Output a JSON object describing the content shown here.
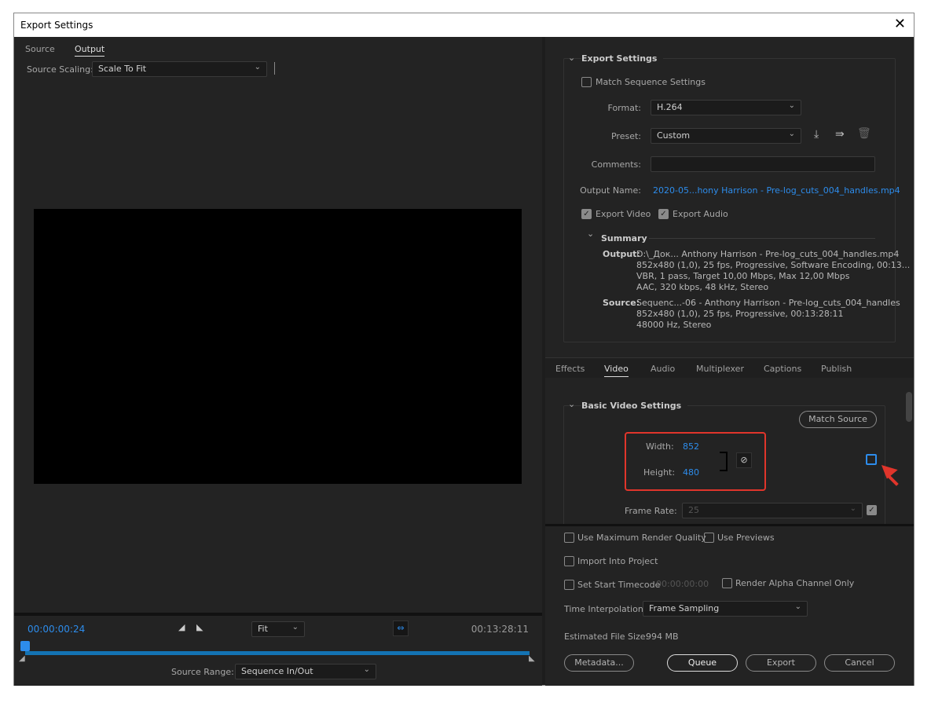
{
  "window": {
    "title": "Export Settings",
    "close_icon": "close-icon"
  },
  "left": {
    "tabs": [
      {
        "label": "Source"
      },
      {
        "label": "Output",
        "active": true
      }
    ],
    "source_scaling_label": "Source Scaling:",
    "source_scaling_value": "Scale To Fit",
    "current_time": "00:00:00:24",
    "fit_value": "Fit",
    "duration": "00:13:28:11",
    "playhead_progress": 0.002,
    "source_range_label": "Source Range:",
    "source_range_value": "Sequence In/Out"
  },
  "export_settings": {
    "title": "Export Settings",
    "match_sequence_label": "Match Sequence Settings",
    "match_sequence_checked": false,
    "format_label": "Format:",
    "format_value": "H.264",
    "preset_label": "Preset:",
    "preset_value": "Custom",
    "comments_label": "Comments:",
    "comments_value": "",
    "output_name_label": "Output Name:",
    "output_name_value": "2020-05...hony Harrison - Pre-log_cuts_004_handles.mp4",
    "export_video_label": "Export Video",
    "export_video_checked": true,
    "export_audio_label": "Export Audio",
    "export_audio_checked": true,
    "summary": {
      "title": "Summary",
      "output_label": "Output:",
      "output_lines": [
        "D:\\_Док... Anthony Harrison - Pre-log_cuts_004_handles.mp4",
        "852x480 (1,0), 25 fps, Progressive, Software Encoding, 00:13...",
        "VBR, 1 pass, Target 10,00 Mbps, Max 12,00 Mbps",
        "AAC, 320 kbps, 48 kHz, Stereo"
      ],
      "source_label": "Source:",
      "source_lines": [
        "Sequenc...-06 - Anthony Harrison - Pre-log_cuts_004_handles",
        "852x480 (1,0), 25 fps, Progressive, 00:13:28:11",
        "48000 Hz, Stereo"
      ]
    }
  },
  "settings_tabs": [
    {
      "label": "Effects"
    },
    {
      "label": "Video",
      "active": true
    },
    {
      "label": "Audio"
    },
    {
      "label": "Multiplexer"
    },
    {
      "label": "Captions"
    },
    {
      "label": "Publish"
    }
  ],
  "basic_video": {
    "title": "Basic Video Settings",
    "match_source_label": "Match Source",
    "width_label": "Width:",
    "width_value": "852",
    "height_label": "Height:",
    "height_value": "480",
    "frame_rate_label": "Frame Rate:",
    "frame_rate_value": "25",
    "frame_rate_checked": true,
    "highlight_color": "#e0352b",
    "accent": "#2d8ceb"
  },
  "bottom": {
    "max_render_label": "Use Maximum Render Quality",
    "use_previews_label": "Use Previews",
    "import_label": "Import Into Project",
    "start_tc_label": "Set Start Timecode",
    "start_tc_value": "00:00:00:00",
    "alpha_label": "Render Alpha Channel Only",
    "time_interp_label": "Time Interpolation:",
    "time_interp_value": "Frame Sampling",
    "file_size_label": "Estimated File Size:",
    "file_size_value": "994 MB",
    "metadata_label": "Metadata...",
    "queue_label": "Queue",
    "export_label": "Export",
    "cancel_label": "Cancel"
  }
}
